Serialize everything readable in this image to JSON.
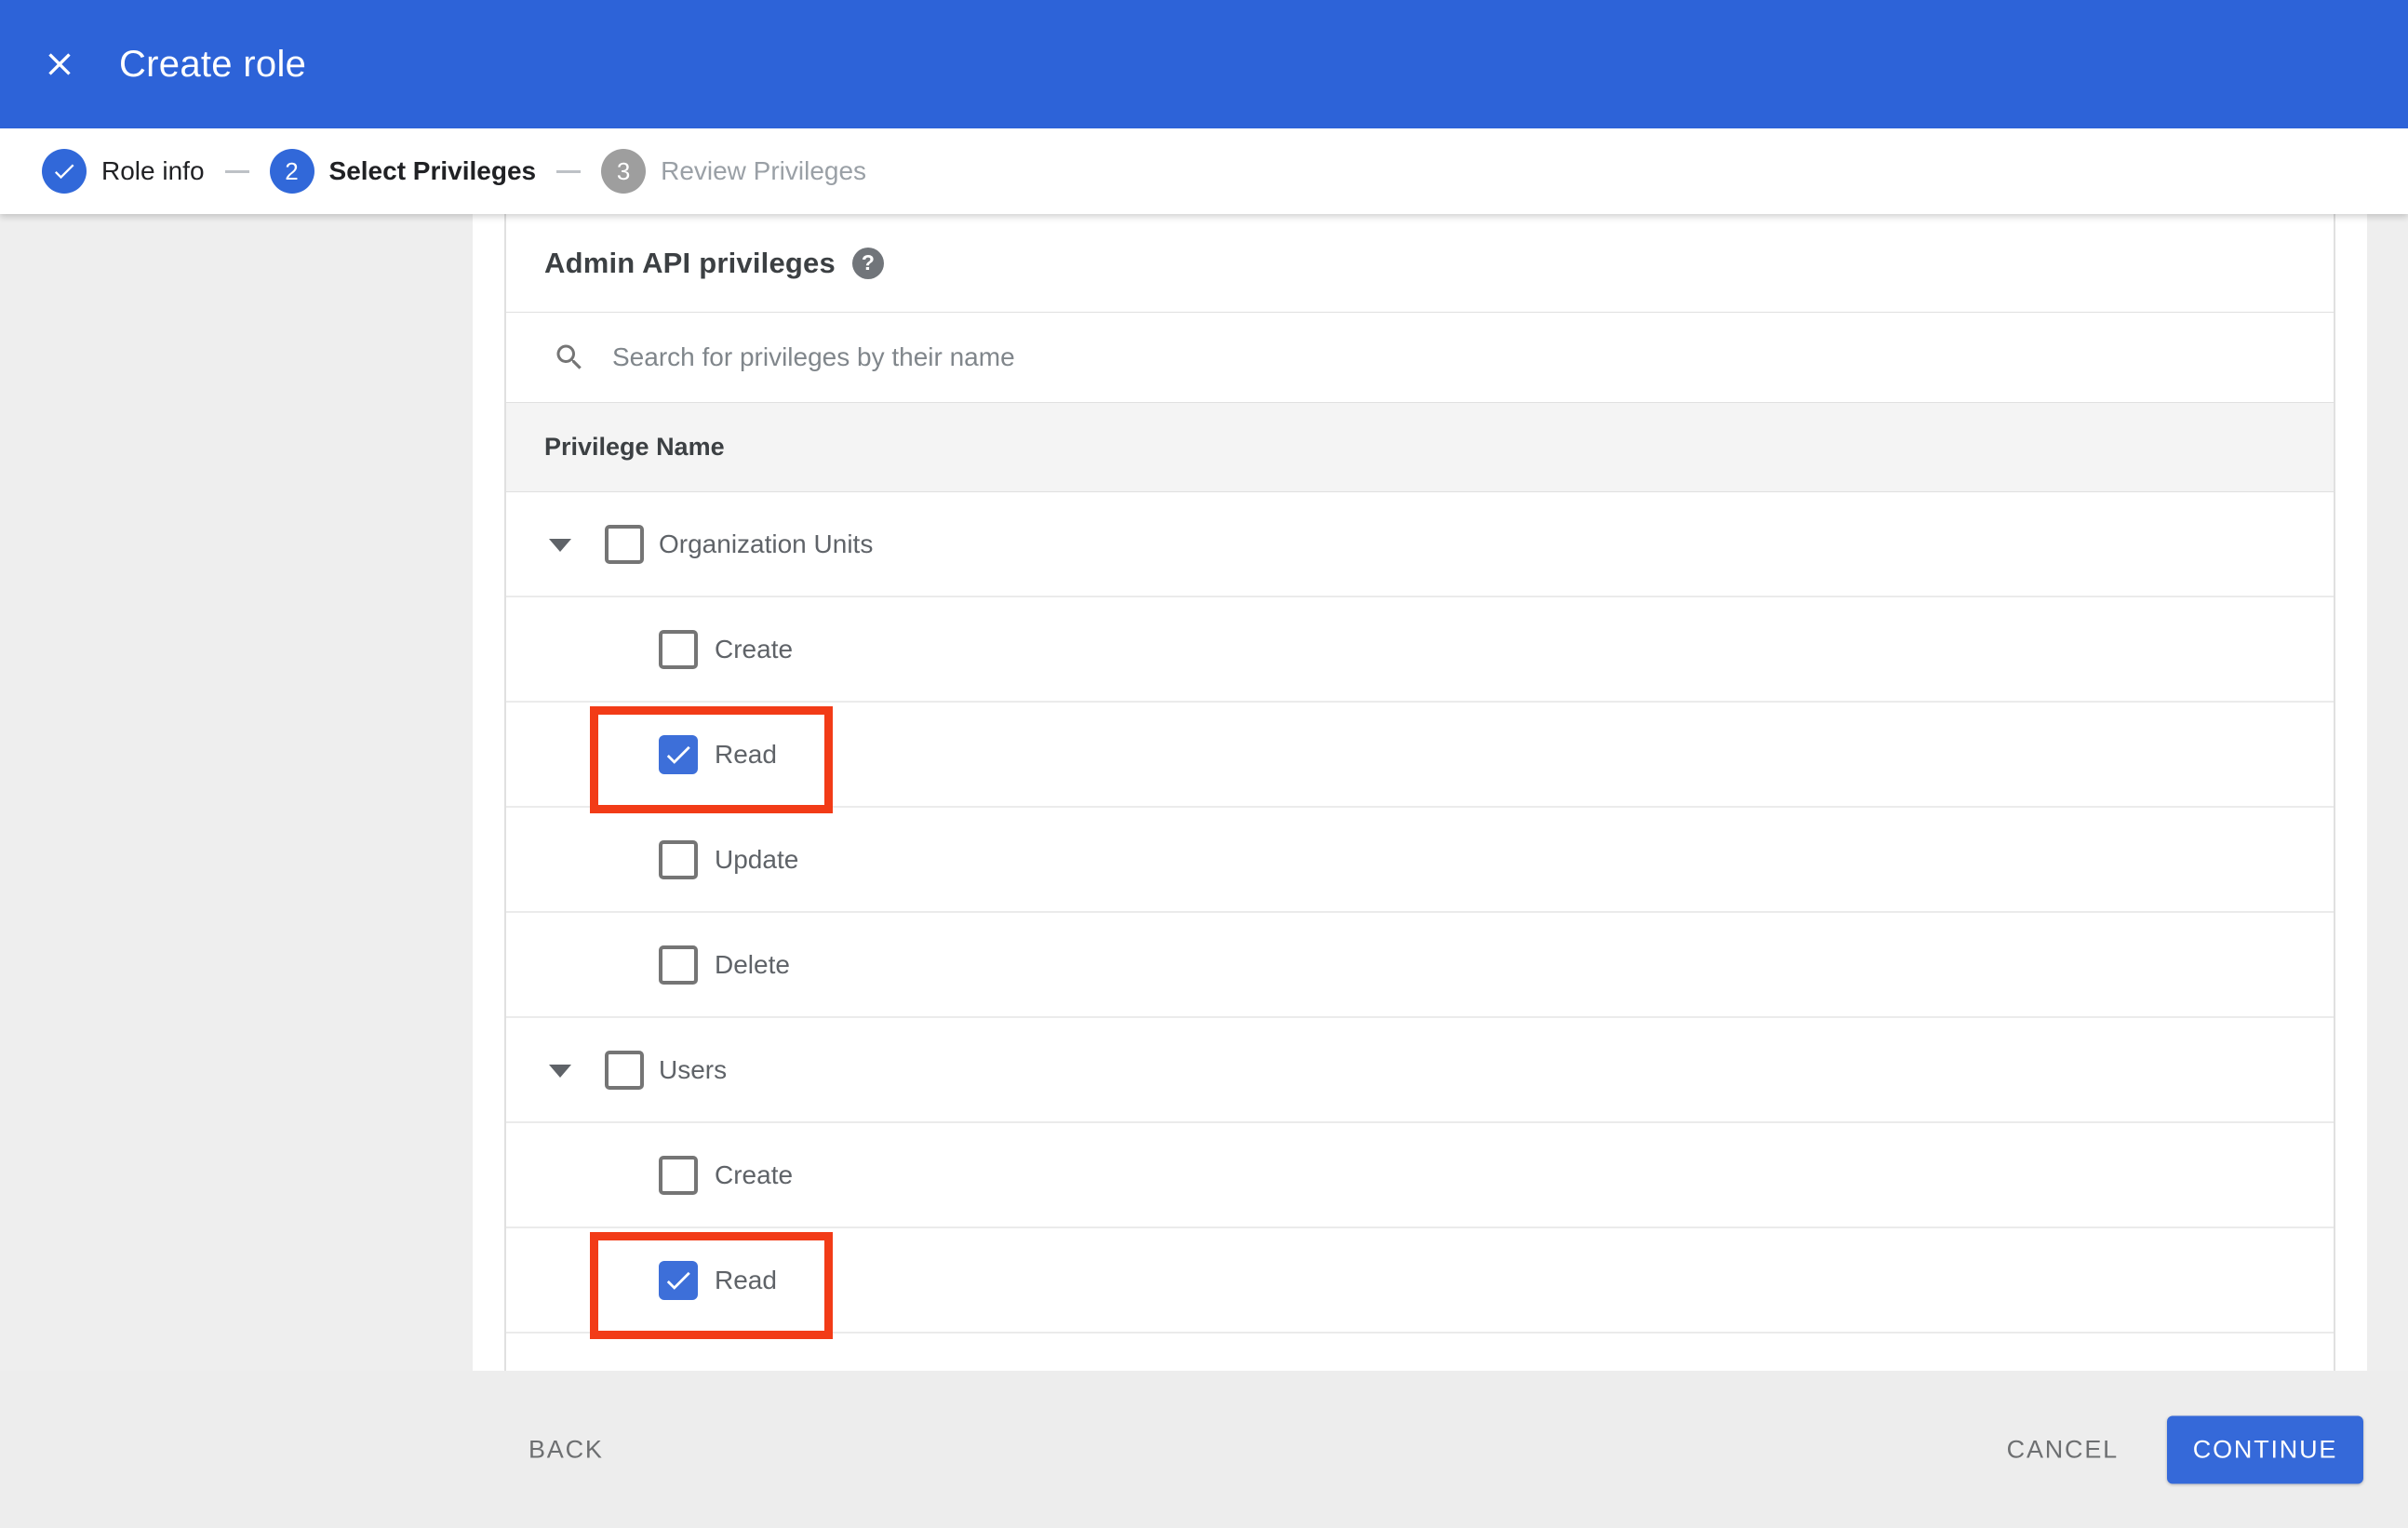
{
  "app_bar": {
    "title": "Create role",
    "close_icon": "close-x"
  },
  "stepper": {
    "steps": [
      {
        "label": "Role info",
        "state": "complete",
        "indicator": "check"
      },
      {
        "label": "Select Privileges",
        "state": "active",
        "indicator": "2"
      },
      {
        "label": "Review Privileges",
        "state": "upcoming",
        "indicator": "3"
      }
    ]
  },
  "content": {
    "section_title": "Admin API privileges",
    "help_icon": "help-question-mark",
    "help_glyph": "?",
    "search": {
      "icon": "search-magnifier",
      "placeholder": "Search for privileges by their name",
      "value": ""
    },
    "table": {
      "header": "Privilege Name",
      "rows": [
        {
          "type": "group",
          "label": "Organization Units",
          "checked": false,
          "expanded": true,
          "highlighted": false
        },
        {
          "type": "child",
          "label": "Create",
          "checked": false,
          "highlighted": false
        },
        {
          "type": "child",
          "label": "Read",
          "checked": true,
          "highlighted": true
        },
        {
          "type": "child",
          "label": "Update",
          "checked": false,
          "highlighted": false
        },
        {
          "type": "child",
          "label": "Delete",
          "checked": false,
          "highlighted": false
        },
        {
          "type": "group",
          "label": "Users",
          "checked": false,
          "expanded": true,
          "highlighted": false
        },
        {
          "type": "child",
          "label": "Create",
          "checked": false,
          "highlighted": false
        },
        {
          "type": "child",
          "label": "Read",
          "checked": true,
          "highlighted": true
        }
      ]
    }
  },
  "footer": {
    "back_label": "BACK",
    "cancel_label": "CANCEL",
    "continue_label": "CONTINUE"
  },
  "colors": {
    "appbar_blue": "#2d63d8",
    "active_step_blue": "#3168d9",
    "checkbox_blue": "#3d6fd9",
    "continue_blue": "#3569d9",
    "highlight_red": "#f23b17",
    "header_bg": "#f4f4f4",
    "footer_bg": "#ededed",
    "page_bg": "#eeeeee",
    "border": "#e0e0e0",
    "label_gray": "#5f6368",
    "placeholder_gray": "#80868b",
    "dark_text": "#3c4043",
    "inactive_gray": "#9e9e9e"
  }
}
